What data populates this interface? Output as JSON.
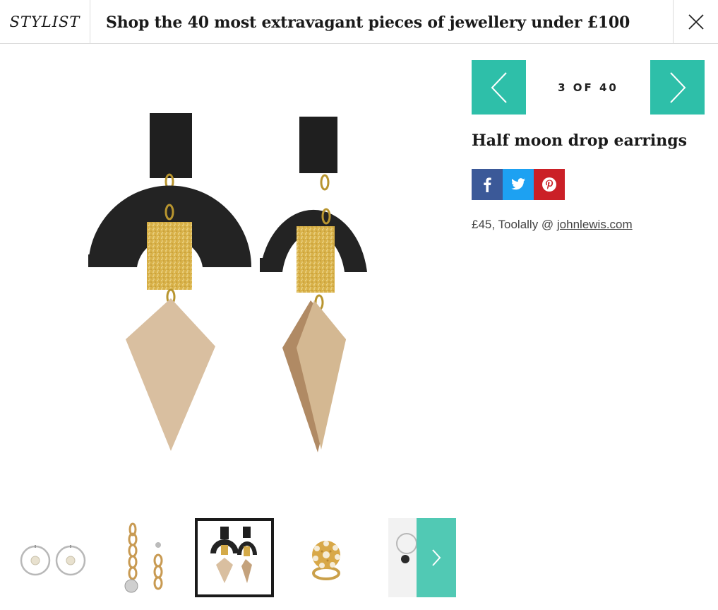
{
  "header": {
    "logo": "STYLIST",
    "title": "Shop the 40 most extravagant pieces of jewellery under £100",
    "close_icon": "close-icon"
  },
  "gallery": {
    "counter": "3 OF 40",
    "prev_icon": "chevron-left-icon",
    "next_icon": "chevron-right-icon",
    "accent_color": "#2ebfa9"
  },
  "item": {
    "title": "Half moon drop earrings",
    "price_text": "£45, Toolally @ ",
    "retailer_link": "johnlewis.com"
  },
  "share": [
    {
      "name": "facebook",
      "icon": "facebook-icon",
      "color": "#3b5998"
    },
    {
      "name": "twitter",
      "icon": "twitter-icon",
      "color": "#1da1f2"
    },
    {
      "name": "pinterest",
      "icon": "pinterest-icon",
      "color": "#cb2027"
    }
  ],
  "thumbnails": {
    "items": [
      "hoop earrings",
      "chain drop earrings",
      "half moon drop earrings",
      "flower ring",
      "hoop charm earrings"
    ],
    "active_index": 2,
    "next_icon": "chevron-right-icon"
  }
}
